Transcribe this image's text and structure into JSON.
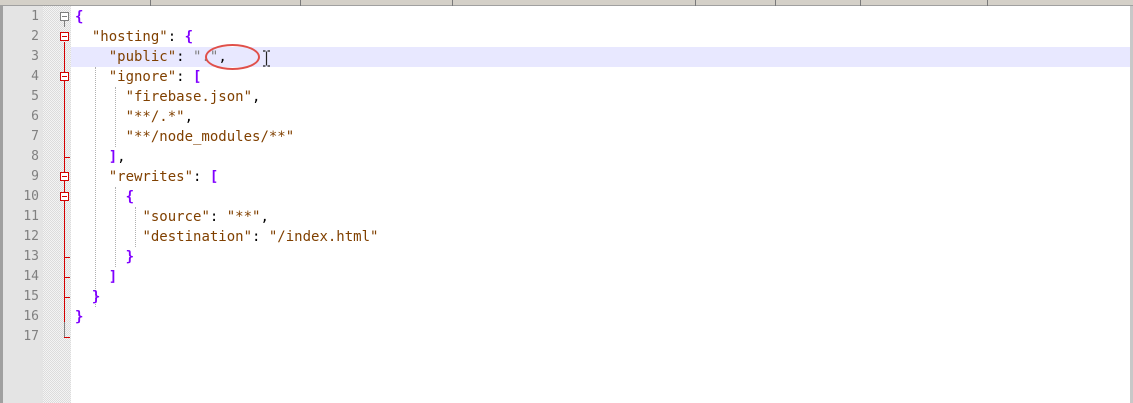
{
  "editor": {
    "line_numbers": [
      "1",
      "2",
      "3",
      "4",
      "5",
      "6",
      "7",
      "8",
      "9",
      "10",
      "11",
      "12",
      "13",
      "14",
      "15",
      "16",
      "17"
    ],
    "current_line": "3",
    "lines": [
      {
        "n": "1",
        "indent": "",
        "tokens": [
          {
            "t": "{",
            "c": "brace"
          }
        ]
      },
      {
        "n": "2",
        "indent": "  ",
        "tokens": [
          {
            "t": "\"hosting\"",
            "c": "key"
          },
          {
            "t": ": ",
            "c": "punct"
          },
          {
            "t": "{",
            "c": "brace"
          }
        ]
      },
      {
        "n": "3",
        "indent": "    ",
        "tokens": [
          {
            "t": "\"public\"",
            "c": "key"
          },
          {
            "t": ": ",
            "c": "punct"
          },
          {
            "t": "\".\"",
            "c": "str"
          },
          {
            "t": ",",
            "c": "punct"
          }
        ]
      },
      {
        "n": "4",
        "indent": "    ",
        "tokens": [
          {
            "t": "\"ignore\"",
            "c": "key"
          },
          {
            "t": ": ",
            "c": "punct"
          },
          {
            "t": "[",
            "c": "brace"
          }
        ]
      },
      {
        "n": "5",
        "indent": "      ",
        "tokens": [
          {
            "t": "\"firebase.json\"",
            "c": "key"
          },
          {
            "t": ",",
            "c": "punct"
          }
        ]
      },
      {
        "n": "6",
        "indent": "      ",
        "tokens": [
          {
            "t": "\"**/.*\"",
            "c": "key"
          },
          {
            "t": ",",
            "c": "punct"
          }
        ]
      },
      {
        "n": "7",
        "indent": "      ",
        "tokens": [
          {
            "t": "\"**/node_modules/**\"",
            "c": "key"
          }
        ]
      },
      {
        "n": "8",
        "indent": "    ",
        "tokens": [
          {
            "t": "]",
            "c": "brace"
          },
          {
            "t": ",",
            "c": "punct"
          }
        ]
      },
      {
        "n": "9",
        "indent": "    ",
        "tokens": [
          {
            "t": "\"rewrites\"",
            "c": "key"
          },
          {
            "t": ": ",
            "c": "punct"
          },
          {
            "t": "[",
            "c": "brace"
          }
        ]
      },
      {
        "n": "10",
        "indent": "      ",
        "tokens": [
          {
            "t": "{",
            "c": "brace"
          }
        ]
      },
      {
        "n": "11",
        "indent": "        ",
        "tokens": [
          {
            "t": "\"source\"",
            "c": "key"
          },
          {
            "t": ": ",
            "c": "punct"
          },
          {
            "t": "\"**\"",
            "c": "key"
          },
          {
            "t": ",",
            "c": "punct"
          }
        ]
      },
      {
        "n": "12",
        "indent": "        ",
        "tokens": [
          {
            "t": "\"destination\"",
            "c": "key"
          },
          {
            "t": ": ",
            "c": "punct"
          },
          {
            "t": "\"/index.html\"",
            "c": "key"
          }
        ]
      },
      {
        "n": "13",
        "indent": "      ",
        "tokens": [
          {
            "t": "}",
            "c": "brace"
          }
        ]
      },
      {
        "n": "14",
        "indent": "    ",
        "tokens": [
          {
            "t": "]",
            "c": "brace"
          }
        ]
      },
      {
        "n": "15",
        "indent": "  ",
        "tokens": [
          {
            "t": "}",
            "c": "brace"
          }
        ]
      },
      {
        "n": "16",
        "indent": "",
        "tokens": [
          {
            "t": "}",
            "c": "brace"
          }
        ]
      },
      {
        "n": "17",
        "indent": "",
        "tokens": []
      }
    ]
  },
  "colors": {
    "key_string": "#804000",
    "value_string": "#808080",
    "operator_brace": "#8000ff",
    "current_line_bg": "#e8e8ff",
    "fold_marker": "#d40000",
    "annotation_circle": "#e0504a"
  },
  "icons": [
    "fold-toggle-icon",
    "text-cursor-icon"
  ]
}
